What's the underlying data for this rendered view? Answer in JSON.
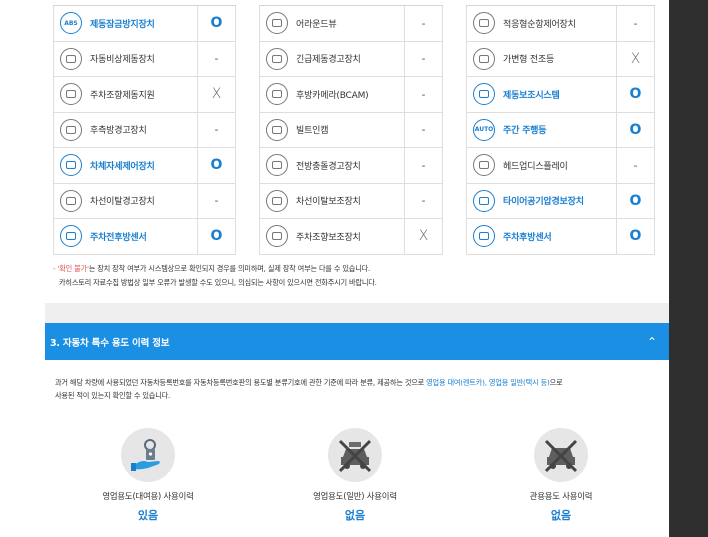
{
  "options": {
    "col1": [
      {
        "icon": "abs-icon",
        "icon_text": "ABS",
        "name": "제동잠금방지장치",
        "highlight": true,
        "mark": "O"
      },
      {
        "icon": "emergency-brake-icon",
        "name": "자동비상제동장치",
        "highlight": false,
        "mark": "-"
      },
      {
        "icon": "parking-brake-assist-icon",
        "name": "주차조향제동지원",
        "highlight": false,
        "mark": "X"
      },
      {
        "icon": "rear-warning-icon",
        "name": "후측방경고장치",
        "highlight": false,
        "mark": "-"
      },
      {
        "icon": "stability-control-icon",
        "name": "차체자세제어장치",
        "highlight": true,
        "mark": "O"
      },
      {
        "icon": "lane-departure-warning-icon",
        "name": "차선이탈경고장치",
        "highlight": false,
        "mark": "-"
      },
      {
        "icon": "parking-sensor-front-rear-icon",
        "name": "주차전후방센서",
        "highlight": true,
        "mark": "O"
      }
    ],
    "col2": [
      {
        "icon": "around-view-icon",
        "name": "어라운드뷰",
        "highlight": false,
        "mark": "-"
      },
      {
        "icon": "emergency-brake-warning-icon",
        "name": "긴급제동경고장치",
        "highlight": false,
        "mark": "-"
      },
      {
        "icon": "rear-camera-icon",
        "name": "후방카메라(BCAM)",
        "highlight": false,
        "mark": "-"
      },
      {
        "icon": "builtin-cam-icon",
        "name": "빌트인캠",
        "highlight": false,
        "mark": "-"
      },
      {
        "icon": "forward-collision-icon",
        "name": "전방충돌경고장치",
        "highlight": false,
        "mark": "-"
      },
      {
        "icon": "lane-keep-assist-icon",
        "name": "차선이탈보조장치",
        "highlight": false,
        "mark": "-"
      },
      {
        "icon": "parking-steer-assist-icon",
        "name": "주차조향보조장치",
        "highlight": false,
        "mark": "X"
      }
    ],
    "col3": [
      {
        "icon": "adaptive-cruise-icon",
        "name": "적응형순항제어장치",
        "highlight": false,
        "mark": "-"
      },
      {
        "icon": "adaptive-headlamp-icon",
        "name": "가변형 전조등",
        "highlight": false,
        "mark": "X"
      },
      {
        "icon": "brake-assist-icon",
        "name": "제동보조시스템",
        "highlight": true,
        "mark": "O"
      },
      {
        "icon": "daytime-running-light-icon",
        "icon_text": "AUTO",
        "name": "주간 주행등",
        "highlight": true,
        "mark": "O"
      },
      {
        "icon": "head-up-display-icon",
        "name": "헤드업디스플레이",
        "highlight": false,
        "mark": "-"
      },
      {
        "icon": "tire-pressure-icon",
        "name": "타이어공기압경보장치",
        "highlight": true,
        "mark": "O"
      },
      {
        "icon": "rear-parking-sensor-icon",
        "name": "주차후방센서",
        "highlight": true,
        "mark": "O"
      }
    ]
  },
  "notes": {
    "line1_red": "- '확인 불가'",
    "line1_rest": "는 장치 장착 여부가 시스템상으로 확인되지 경우를 의미하며, 실제 장착 여부는 다를 수 있습니다.",
    "line2": "카히스토리 자료수집 방법상 일부 오류가 발생할 수도 있으니, 의심되는 사항이 있으시면 전화주시기 바랍니다."
  },
  "section": {
    "title": "3. 자동차 특수 용도 이력 정보",
    "chevron": "⌃"
  },
  "description": {
    "part1": "과거 해당 차량에 사용되었던 자동차등록번호를 자동차등록번호판의 용도별 분류기호에 관한 기준에 따라 분류, 제공하는 것으로 ",
    "highlight": "영업용 대여(렌트카), 영업용 일반(택시 등)",
    "part2": "으로",
    "line2": "사용된 적이 있는지 확인할 수 있습니다."
  },
  "usage": [
    {
      "icon": "rental-key-icon",
      "label": "영업용도(대여용) 사용이력",
      "value": "있음"
    },
    {
      "icon": "taxi-crossed-icon",
      "label": "영업용도(일반) 사용이력",
      "value": "없음"
    },
    {
      "icon": "government-car-crossed-icon",
      "label": "관용용도 사용이력",
      "value": "없음"
    }
  ]
}
